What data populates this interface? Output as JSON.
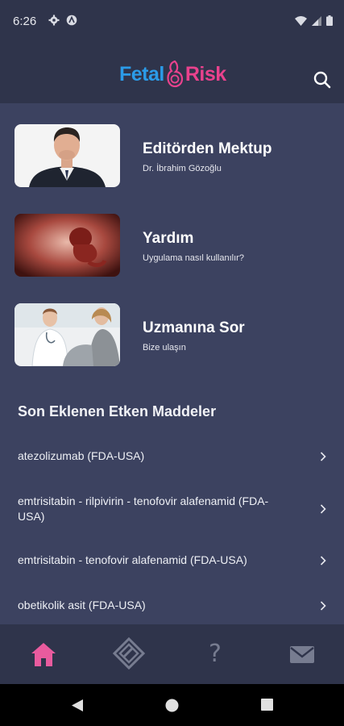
{
  "status_bar": {
    "time": "6:26"
  },
  "header": {
    "logo_left": "Fetal",
    "logo_right": "Risk",
    "search_icon": "search-icon"
  },
  "cards": [
    {
      "title": "Editörden Mektup",
      "subtitle": "Dr. İbrahim Gözoğlu",
      "image": "doctor-portrait"
    },
    {
      "title": "Yardım",
      "subtitle": "Uygulama nasıl kullanılır?",
      "image": "fetus-image"
    },
    {
      "title": "Uzmanına Sor",
      "subtitle": "Bize ulaşın",
      "image": "doctor-patient-image"
    }
  ],
  "recent": {
    "title": "Son Eklenen Etken Maddeler",
    "items": [
      {
        "label": "atezolizumab (FDA-USA)"
      },
      {
        "label": "emtrisitabin - rilpivirin - tenofovir alafenamid (FDA-USA)"
      },
      {
        "label": "emtrisitabin - tenofovir alafenamid (FDA-USA)"
      },
      {
        "label": "obetikolik asit (FDA-USA)"
      }
    ]
  },
  "bottom_nav": {
    "help_glyph": "?",
    "active_color": "#e95b9e",
    "inactive_color": "#777c90"
  },
  "colors": {
    "background": "#3c4260",
    "header": "#2f344b",
    "logo_blue": "#2b9be8",
    "logo_pink": "#e9428d"
  }
}
